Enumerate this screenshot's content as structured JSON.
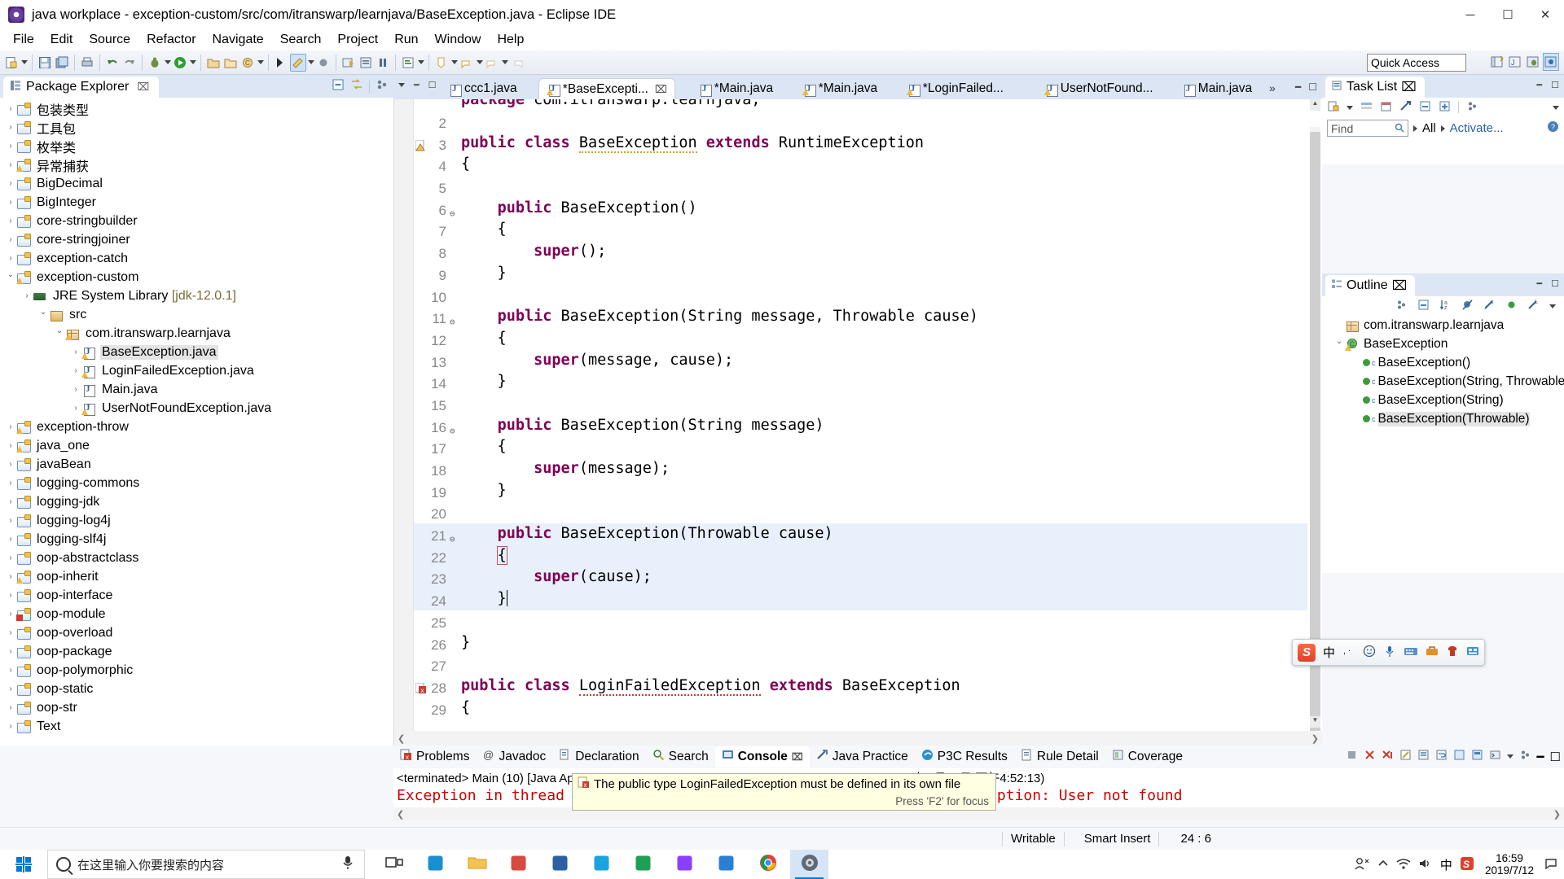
{
  "window": {
    "title": "java workplace - exception-custom/src/com/itranswarp/learnjava/BaseException.java - Eclipse IDE",
    "minimize": "─",
    "maximize": "☐",
    "close": "✕"
  },
  "menu": {
    "items": [
      "File",
      "Edit",
      "Source",
      "Refactor",
      "Navigate",
      "Search",
      "Project",
      "Run",
      "Window",
      "Help"
    ]
  },
  "toolbar": {
    "quick_access_label": "Quick Access"
  },
  "package_explorer": {
    "title": "Package Explorer",
    "close_glyph": "⌧",
    "items": [
      {
        "label": "包装类型",
        "depth": 0,
        "arrow": "closed",
        "icon": "folder"
      },
      {
        "label": "工具包",
        "depth": 0,
        "arrow": "closed",
        "icon": "folder"
      },
      {
        "label": "枚举类",
        "depth": 0,
        "arrow": "closed",
        "icon": "folder"
      },
      {
        "label": "异常捕获",
        "depth": 0,
        "arrow": "closed",
        "icon": "folder-warn"
      },
      {
        "label": "BigDecimal",
        "depth": 0,
        "arrow": "closed",
        "icon": "folder"
      },
      {
        "label": "BigInteger",
        "depth": 0,
        "arrow": "closed",
        "icon": "folder"
      },
      {
        "label": "core-stringbuilder",
        "depth": 0,
        "arrow": "closed",
        "icon": "folder"
      },
      {
        "label": "core-stringjoiner",
        "depth": 0,
        "arrow": "closed",
        "icon": "folder"
      },
      {
        "label": "exception-catch",
        "depth": 0,
        "arrow": "closed",
        "icon": "folder"
      },
      {
        "label": "exception-custom",
        "depth": 0,
        "arrow": "open",
        "icon": "folder-warn"
      },
      {
        "label": "JRE System Library",
        "suffix": " [jdk-12.0.1]",
        "depth": 1,
        "arrow": "closed",
        "icon": "jre"
      },
      {
        "label": "src",
        "depth": 2,
        "arrow": "open",
        "icon": "pkgroot"
      },
      {
        "label": "com.itranswarp.learnjava",
        "depth": 3,
        "arrow": "open",
        "icon": "package-warn"
      },
      {
        "label": "BaseException.java",
        "depth": 4,
        "arrow": "closed",
        "icon": "java-warn",
        "selected": true
      },
      {
        "label": "LoginFailedException.java",
        "depth": 4,
        "arrow": "closed",
        "icon": "java-warn"
      },
      {
        "label": "Main.java",
        "depth": 4,
        "arrow": "closed",
        "icon": "java"
      },
      {
        "label": "UserNotFoundException.java",
        "depth": 4,
        "arrow": "closed",
        "icon": "java-warn"
      },
      {
        "label": "exception-throw",
        "depth": 0,
        "arrow": "closed",
        "icon": "folder-warn"
      },
      {
        "label": "java_one",
        "depth": 0,
        "arrow": "closed",
        "icon": "folder-warn"
      },
      {
        "label": "javaBean",
        "depth": 0,
        "arrow": "closed",
        "icon": "folder"
      },
      {
        "label": "logging-commons",
        "depth": 0,
        "arrow": "closed",
        "icon": "folder"
      },
      {
        "label": "logging-jdk",
        "depth": 0,
        "arrow": "closed",
        "icon": "folder"
      },
      {
        "label": "logging-log4j",
        "depth": 0,
        "arrow": "closed",
        "icon": "folder"
      },
      {
        "label": "logging-slf4j",
        "depth": 0,
        "arrow": "closed",
        "icon": "folder"
      },
      {
        "label": "oop-abstractclass",
        "depth": 0,
        "arrow": "closed",
        "icon": "folder"
      },
      {
        "label": "oop-inherit",
        "depth": 0,
        "arrow": "closed",
        "icon": "folder-warn"
      },
      {
        "label": "oop-interface",
        "depth": 0,
        "arrow": "closed",
        "icon": "folder"
      },
      {
        "label": "oop-module",
        "depth": 0,
        "arrow": "closed",
        "icon": "folder-err"
      },
      {
        "label": "oop-overload",
        "depth": 0,
        "arrow": "closed",
        "icon": "folder"
      },
      {
        "label": "oop-package",
        "depth": 0,
        "arrow": "closed",
        "icon": "folder"
      },
      {
        "label": "oop-polymorphic",
        "depth": 0,
        "arrow": "closed",
        "icon": "folder"
      },
      {
        "label": "oop-static",
        "depth": 0,
        "arrow": "closed",
        "icon": "folder"
      },
      {
        "label": "oop-str",
        "depth": 0,
        "arrow": "closed",
        "icon": "folder"
      },
      {
        "label": "Text",
        "depth": 0,
        "arrow": "closed",
        "icon": "folder"
      }
    ]
  },
  "editor": {
    "tabs": [
      {
        "label": "ccc1.java",
        "dirty": false,
        "active": false,
        "warn": false
      },
      {
        "label": "*BaseExcepti...",
        "dirty": true,
        "active": true,
        "warn": true,
        "closeable": true
      },
      {
        "label": "*Main.java",
        "dirty": true,
        "active": false,
        "warn": false
      },
      {
        "label": "*Main.java",
        "dirty": true,
        "active": false,
        "warn": true
      },
      {
        "label": "*LoginFailed...",
        "dirty": true,
        "active": false,
        "warn": true
      },
      {
        "label": "UserNotFound...",
        "dirty": false,
        "active": false,
        "warn": true
      },
      {
        "label": "Main.java",
        "dirty": false,
        "active": false,
        "warn": false
      }
    ],
    "more_tabs_indicator": "»",
    "lines": [
      {
        "num": "1",
        "text": "package com.itranswarp.learnjava;",
        "clipped_top": true
      },
      {
        "num": "2",
        "text": ""
      },
      {
        "num": "3",
        "text": "public class BaseException extends RuntimeException",
        "marker": "warn",
        "warn_token": "BaseException"
      },
      {
        "num": "4",
        "text": "{"
      },
      {
        "num": "5",
        "text": ""
      },
      {
        "num": "6",
        "text": "    public BaseException()",
        "fold": true
      },
      {
        "num": "7",
        "text": "    {"
      },
      {
        "num": "8",
        "text": "        super();"
      },
      {
        "num": "9",
        "text": "    }"
      },
      {
        "num": "10",
        "text": ""
      },
      {
        "num": "11",
        "text": "    public BaseException(String message, Throwable cause)",
        "fold": true
      },
      {
        "num": "12",
        "text": "    {"
      },
      {
        "num": "13",
        "text": "        super(message, cause);"
      },
      {
        "num": "14",
        "text": "    }"
      },
      {
        "num": "15",
        "text": ""
      },
      {
        "num": "16",
        "text": "    public BaseException(String message)",
        "fold": true
      },
      {
        "num": "17",
        "text": "    {"
      },
      {
        "num": "18",
        "text": "        super(message);"
      },
      {
        "num": "19",
        "text": "    }"
      },
      {
        "num": "20",
        "text": ""
      },
      {
        "num": "21",
        "text": "    public BaseException(Throwable cause)",
        "fold": true,
        "highlight": true
      },
      {
        "num": "22",
        "text": "    {",
        "highlight": true,
        "brace": true
      },
      {
        "num": "23",
        "text": "        super(cause);",
        "highlight": true
      },
      {
        "num": "24",
        "text": "    }",
        "highlight": true,
        "caret": true
      },
      {
        "num": "25",
        "text": ""
      },
      {
        "num": "26",
        "text": "}"
      },
      {
        "num": "27",
        "text": ""
      },
      {
        "num": "28",
        "text": "public class LoginFailedException extends BaseException",
        "marker": "err",
        "err_token": "LoginFailedException"
      },
      {
        "num": "29",
        "text": "{"
      }
    ],
    "tooltip": {
      "message": "The public type LoginFailedException must be defined in its own file",
      "hint": "Press 'F2' for focus"
    }
  },
  "task_list": {
    "title": "Task List",
    "close_glyph": "⌧",
    "find_placeholder": "Find",
    "all_label": "All",
    "activate_label": "Activate..."
  },
  "outline": {
    "title": "Outline",
    "close_glyph": "⌧",
    "items": [
      {
        "label": "com.itranswarp.learnjava",
        "depth": 0,
        "icon": "package",
        "arrow": "none"
      },
      {
        "label": "BaseException",
        "depth": 0,
        "icon": "class-warn",
        "arrow": "open"
      },
      {
        "label": "BaseException()",
        "depth": 1,
        "icon": "method",
        "arrow": "none"
      },
      {
        "label": "BaseException(String, Throwable)",
        "depth": 1,
        "icon": "method",
        "arrow": "none"
      },
      {
        "label": "BaseException(String)",
        "depth": 1,
        "icon": "method",
        "arrow": "none"
      },
      {
        "label": "BaseException(Throwable)",
        "depth": 1,
        "icon": "method",
        "arrow": "none",
        "selected": true
      }
    ]
  },
  "console": {
    "tabs": [
      {
        "label": "Problems",
        "icon": "problems-icon",
        "active": false
      },
      {
        "label": "Javadoc",
        "icon": "javadoc-icon",
        "active": false
      },
      {
        "label": "Declaration",
        "icon": "declaration-icon",
        "active": false
      },
      {
        "label": "Search",
        "icon": "search-icon",
        "active": false
      },
      {
        "label": "Console",
        "icon": "console-icon",
        "active": true,
        "closeable": true
      },
      {
        "label": "Java Practice",
        "icon": "java-practice-icon",
        "active": false
      },
      {
        "label": "P3C Results",
        "icon": "p3c-icon",
        "active": false
      },
      {
        "label": "Rule Detail",
        "icon": "rule-detail-icon",
        "active": false
      },
      {
        "label": "Coverage",
        "icon": "coverage-icon",
        "active": false
      }
    ],
    "close_glyph": "⌧",
    "header_line": "<terminated> Main (10) [Java Application] C:\\Program Files\\Java\\jdk-12.0.1\\bin\\javaw.exe (2019年7月12日 下午4:52:13)",
    "output_line": "Exception in thread \"main\" com.itranswarp.learnjava.UserNotFoundException: User not found"
  },
  "status_bar": {
    "writable": "Writable",
    "insert_mode": "Smart Insert",
    "position": "24 : 6"
  },
  "ime": {
    "lang_label": "中",
    "items": [
      "sogou-logo",
      "chinese-mode",
      "punctuation",
      "emoji",
      "voice",
      "keyboard",
      "toolbox",
      "skin",
      "menu"
    ]
  },
  "taskbar": {
    "search_placeholder": "在这里输入你要搜索的内容",
    "apps": [
      {
        "name": "task-view",
        "color": "#2b2b2b"
      },
      {
        "name": "edge",
        "color": "#1a8fd1"
      },
      {
        "name": "file-explorer",
        "color": "#f6b93b"
      },
      {
        "name": "microsoft-store",
        "color": "#d84a3f"
      },
      {
        "name": "mail",
        "color": "#2e5fa3"
      },
      {
        "name": "qq-browser",
        "color": "#1aa3dd"
      },
      {
        "name": "pycharm",
        "color": "#1f9e55"
      },
      {
        "name": "datagrip",
        "color": "#8a3ffc"
      },
      {
        "name": "vscode",
        "color": "#2a7fd4"
      },
      {
        "name": "chrome",
        "color": "#e44235"
      },
      {
        "name": "eclipse",
        "color": "#4b2a73",
        "active": true
      }
    ],
    "clock_time": "16:59",
    "clock_date": "2019/7/12",
    "lang_indicator": "中"
  }
}
